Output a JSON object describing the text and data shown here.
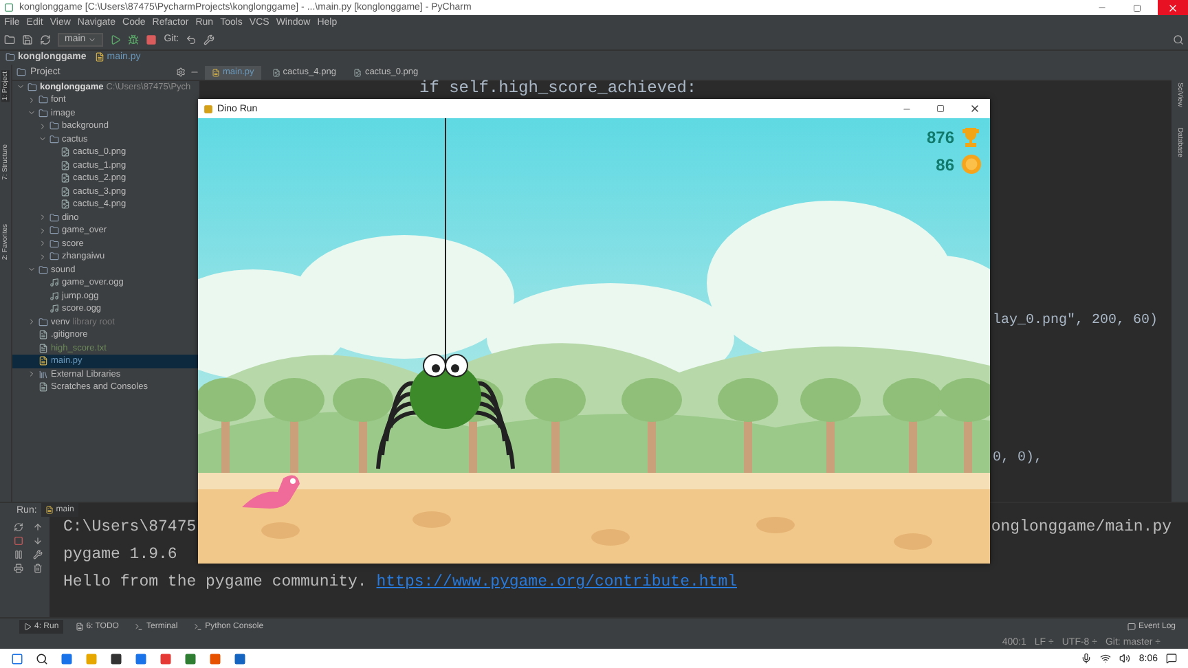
{
  "window": {
    "title": "konglonggame [C:\\Users\\87475\\PycharmProjects\\konglonggame] - ...\\main.py [konglonggame] - PyCharm"
  },
  "menu": [
    "File",
    "Edit",
    "View",
    "Navigate",
    "Code",
    "Refactor",
    "Run",
    "Tools",
    "VCS",
    "Window",
    "Help"
  ],
  "toolbar": {
    "run_config": "main",
    "vcs_label": "Git:"
  },
  "breadcrumb": [
    {
      "label": "konglonggame",
      "kind": "folder"
    },
    {
      "label": "main.py",
      "kind": "file"
    }
  ],
  "side_tabs_left": [
    {
      "label": "1: Project",
      "selected": true
    },
    {
      "label": "7: Structure",
      "selected": false
    },
    {
      "label": "2: Favorites",
      "selected": false
    }
  ],
  "side_tabs_right": [
    "SciView",
    "Database"
  ],
  "project_panel": {
    "title": "Project",
    "root": {
      "label": "konglonggame",
      "path": "C:\\Users\\87475\\Pych"
    },
    "tree": [
      {
        "label": "font",
        "kind": "folder",
        "expanded": false,
        "selected": false
      },
      {
        "label": "image",
        "kind": "folder",
        "expanded": true,
        "selected": false,
        "children": [
          {
            "label": "background",
            "kind": "folder",
            "expanded": false,
            "selected": false
          },
          {
            "label": "cactus",
            "kind": "folder",
            "expanded": true,
            "selected": false,
            "children": [
              {
                "label": "cactus_0.png",
                "kind": "image",
                "selected": false
              },
              {
                "label": "cactus_1.png",
                "kind": "image",
                "selected": false
              },
              {
                "label": "cactus_2.png",
                "kind": "image",
                "selected": false
              },
              {
                "label": "cactus_3.png",
                "kind": "image",
                "selected": false
              },
              {
                "label": "cactus_4.png",
                "kind": "image",
                "selected": false
              }
            ]
          },
          {
            "label": "dino",
            "kind": "folder",
            "expanded": false,
            "selected": false
          },
          {
            "label": "game_over",
            "kind": "folder",
            "expanded": false,
            "selected": false
          },
          {
            "label": "score",
            "kind": "folder",
            "expanded": false,
            "selected": false
          },
          {
            "label": "zhangaiwu",
            "kind": "folder",
            "expanded": false,
            "selected": false
          }
        ]
      },
      {
        "label": "sound",
        "kind": "folder",
        "expanded": true,
        "selected": false,
        "children": [
          {
            "label": "game_over.ogg",
            "kind": "audio",
            "selected": false
          },
          {
            "label": "jump.ogg",
            "kind": "audio",
            "selected": false
          },
          {
            "label": "score.ogg",
            "kind": "audio",
            "selected": false
          }
        ]
      },
      {
        "label": "venv",
        "note": "library root",
        "kind": "folder",
        "expanded": false,
        "selected": false
      },
      {
        "label": ".gitignore",
        "kind": "text",
        "selected": false
      },
      {
        "label": "high_score.txt",
        "kind": "text",
        "selected": false
      },
      {
        "label": "main.py",
        "kind": "python",
        "selected": true
      },
      {
        "label": "External Libraries",
        "kind": "library",
        "expanded": false,
        "selected": false
      },
      {
        "label": "Scratches and Consoles",
        "kind": "scratch",
        "selected": false
      }
    ]
  },
  "editor_tabs": [
    {
      "label": "main.py",
      "kind": "python",
      "selected": true
    },
    {
      "label": "cactus_4.png",
      "kind": "image",
      "selected": false
    },
    {
      "label": "cactus_0.png",
      "kind": "image",
      "selected": false
    }
  ],
  "editor_code_top": [
    "if self.high_score_achieved:"
  ],
  "editor_code_right": [
    "lay_0.png\", 200, 60)",
    "0, 0),"
  ],
  "game_window": {
    "title": "Dino Run",
    "score": "876",
    "coins": "86"
  },
  "run_panel": {
    "label": "Run:",
    "config": "main",
    "lines": [
      {
        "left": "C:\\Users\\87475",
        "right": "onglonggame/main.py"
      },
      {
        "left": "pygame 1.9.6"
      },
      {
        "left": "Hello from the pygame community. ",
        "link": "https://www.pygame.org/contribute.html"
      }
    ]
  },
  "tool_tabs": [
    {
      "label": "4: Run",
      "kind": "run",
      "selected": true
    },
    {
      "label": "6: TODO",
      "kind": "todo",
      "selected": false
    },
    {
      "label": "Terminal",
      "kind": "terminal",
      "selected": false
    },
    {
      "label": "Python Console",
      "kind": "console",
      "selected": false
    }
  ],
  "event_log": "Event Log",
  "status_bar": [
    "400:1",
    "LF ÷",
    "UTF-8 ÷",
    "Git: master ÷"
  ],
  "taskbar": {
    "time": "8:06"
  }
}
